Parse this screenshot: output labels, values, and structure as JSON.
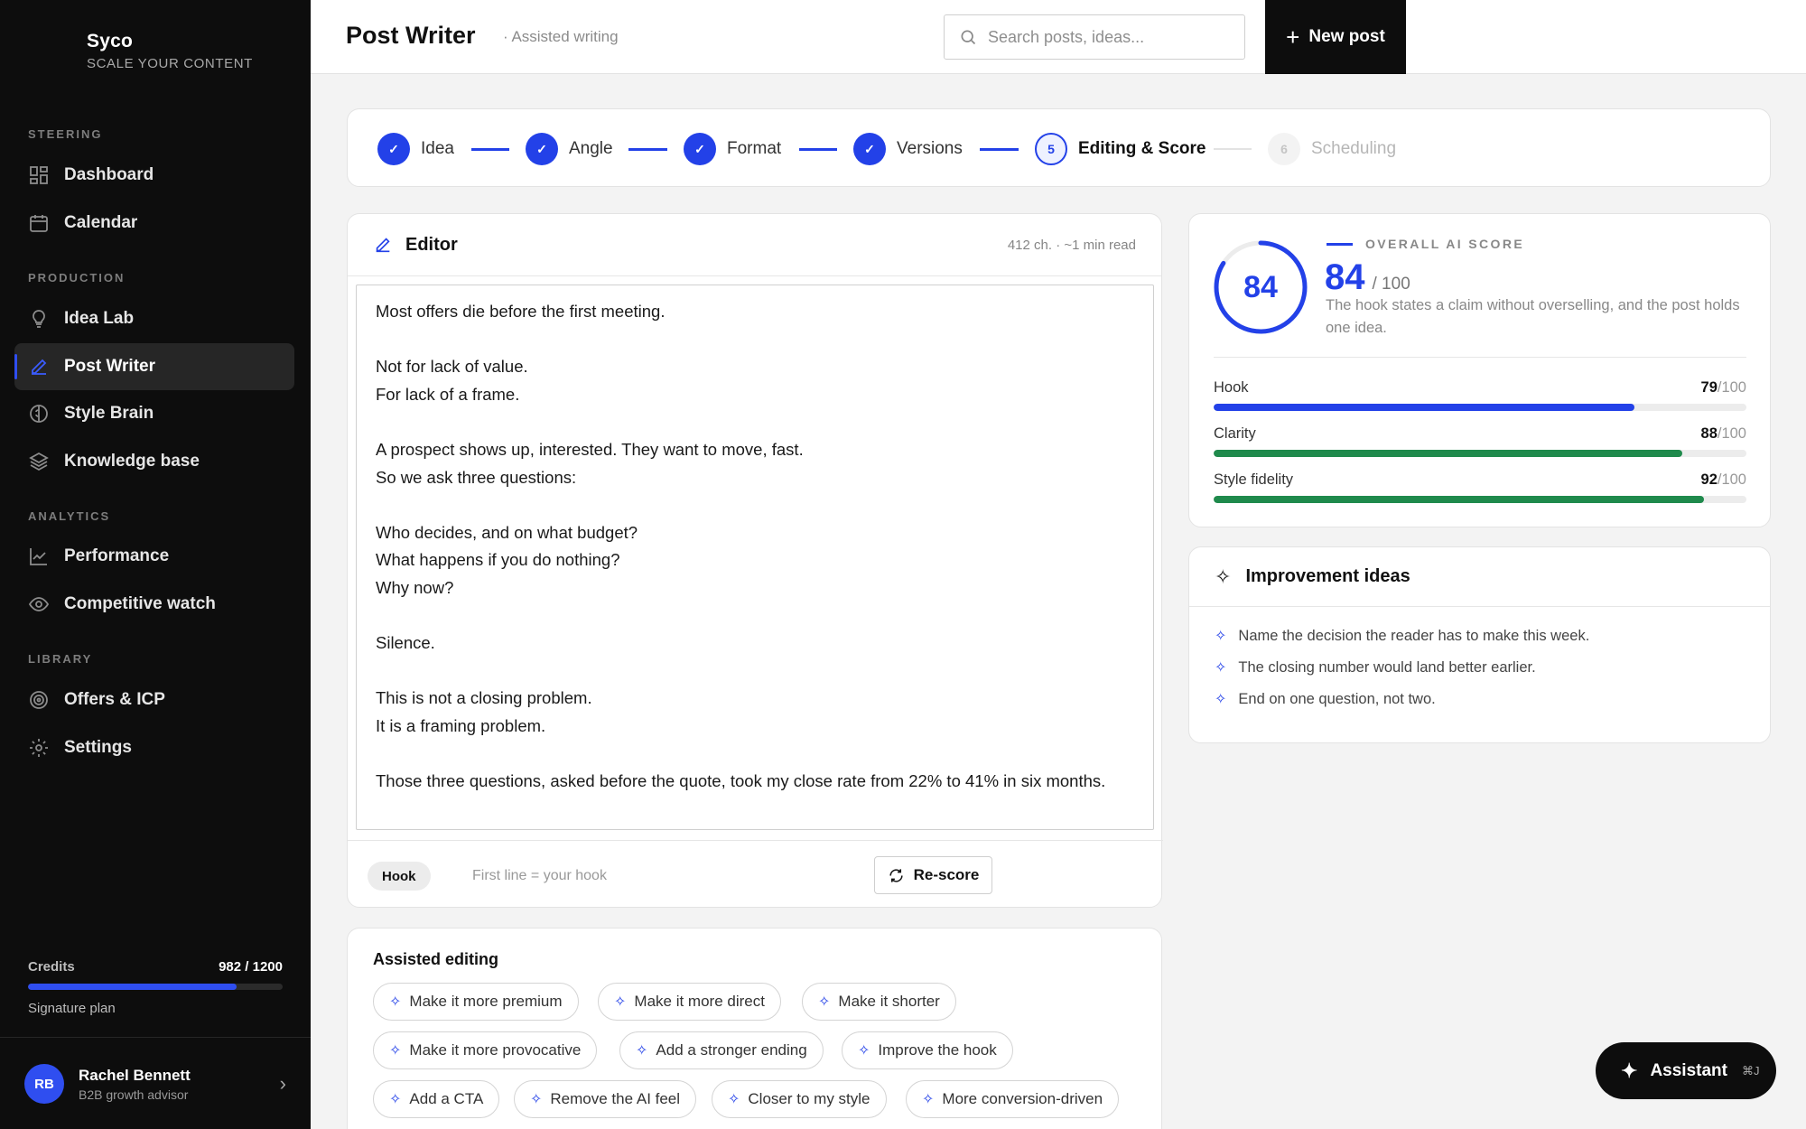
{
  "brand": {
    "name": "Syco",
    "tagline": "SCALE YOUR CONTENT"
  },
  "sidebar": {
    "sections": [
      {
        "label": "STEERING"
      },
      {
        "label": "PRODUCTION"
      },
      {
        "label": "ANALYTICS"
      },
      {
        "label": "LIBRARY"
      }
    ],
    "items": [
      {
        "label": "Dashboard",
        "icon": "dashboard-icon"
      },
      {
        "label": "Calendar",
        "icon": "calendar-icon"
      },
      {
        "label": "Idea Lab",
        "icon": "lightbulb-icon"
      },
      {
        "label": "Post Writer",
        "icon": "pen-icon",
        "active": true
      },
      {
        "label": "Style Brain",
        "icon": "brain-icon"
      },
      {
        "label": "Knowledge base",
        "icon": "layers-icon"
      },
      {
        "label": "Performance",
        "icon": "line-chart-icon"
      },
      {
        "label": "Competitive watch",
        "icon": "eye-icon"
      },
      {
        "label": "Offers & ICP",
        "icon": "target-icon"
      },
      {
        "label": "Settings",
        "icon": "gear-icon"
      }
    ],
    "credits": {
      "label": "Credits",
      "value": "982 / 1200",
      "used": 982,
      "total": 1200,
      "plan": "Signature plan"
    },
    "user": {
      "initials": "RB",
      "name": "Rachel Bennett",
      "role": "B2B growth advisor"
    }
  },
  "header": {
    "title": "Post Writer",
    "subtitle": "· Assisted writing",
    "search_placeholder": "Search posts, ideas...",
    "new_post_label": "New post"
  },
  "stepper": {
    "steps": [
      {
        "number": "1",
        "label": "Idea",
        "state": "done"
      },
      {
        "number": "2",
        "label": "Angle",
        "state": "done"
      },
      {
        "number": "3",
        "label": "Format",
        "state": "done"
      },
      {
        "number": "4",
        "label": "Versions",
        "state": "done"
      },
      {
        "number": "5",
        "label": "Editing & Score",
        "state": "current"
      },
      {
        "number": "6",
        "label": "Scheduling",
        "state": "todo"
      }
    ]
  },
  "editor": {
    "title": "Editor",
    "meta": "412 ch. · ~1 min read",
    "text": "Most offers die before the first meeting.\n\nNot for lack of value.\nFor lack of a frame.\n\nA prospect shows up, interested. They want to move, fast.\nSo we ask three questions:\n\nWho decides, and on what budget?\nWhat happens if you do nothing?\nWhy now?\n\nSilence.\n\nThis is not a closing problem.\nIt is a framing problem.\n\nThose three questions, asked before the quote, took my close rate from 22% to 41% in six months.",
    "hook_chip": "Hook",
    "hook_hint": "First line = your hook",
    "rescore_label": "Re-score"
  },
  "assisted": {
    "title": "Assisted editing",
    "suggestions": [
      "Make it more premium",
      "Make it more direct",
      "Make it shorter",
      "Make it more provocative",
      "Add a stronger ending",
      "Improve the hook",
      "Add a CTA",
      "Remove the AI feel",
      "Closer to my style",
      "More conversion-driven"
    ]
  },
  "score": {
    "label": "OVERALL AI SCORE",
    "value": "84",
    "max_text": "/ 100",
    "value_num": 84,
    "description": "The hook states a claim without overselling, and the post holds one idea.",
    "accent": "#2341e8",
    "metrics": [
      {
        "name": "Hook",
        "value": "79",
        "max": "/100",
        "num": 79,
        "color": "#2341e8"
      },
      {
        "name": "Clarity",
        "value": "88",
        "max": "/100",
        "num": 88,
        "color": "#1f8a4c"
      },
      {
        "name": "Style fidelity",
        "value": "92",
        "max": "/100",
        "num": 92,
        "color": "#1f8a4c"
      }
    ]
  },
  "improvement": {
    "title": "Improvement ideas",
    "ideas": [
      "Name the decision the reader has to make this week.",
      "The closing number would land better earlier.",
      "End on one question, not two."
    ]
  },
  "assistant": {
    "label": "Assistant",
    "shortcut": "⌘J"
  }
}
